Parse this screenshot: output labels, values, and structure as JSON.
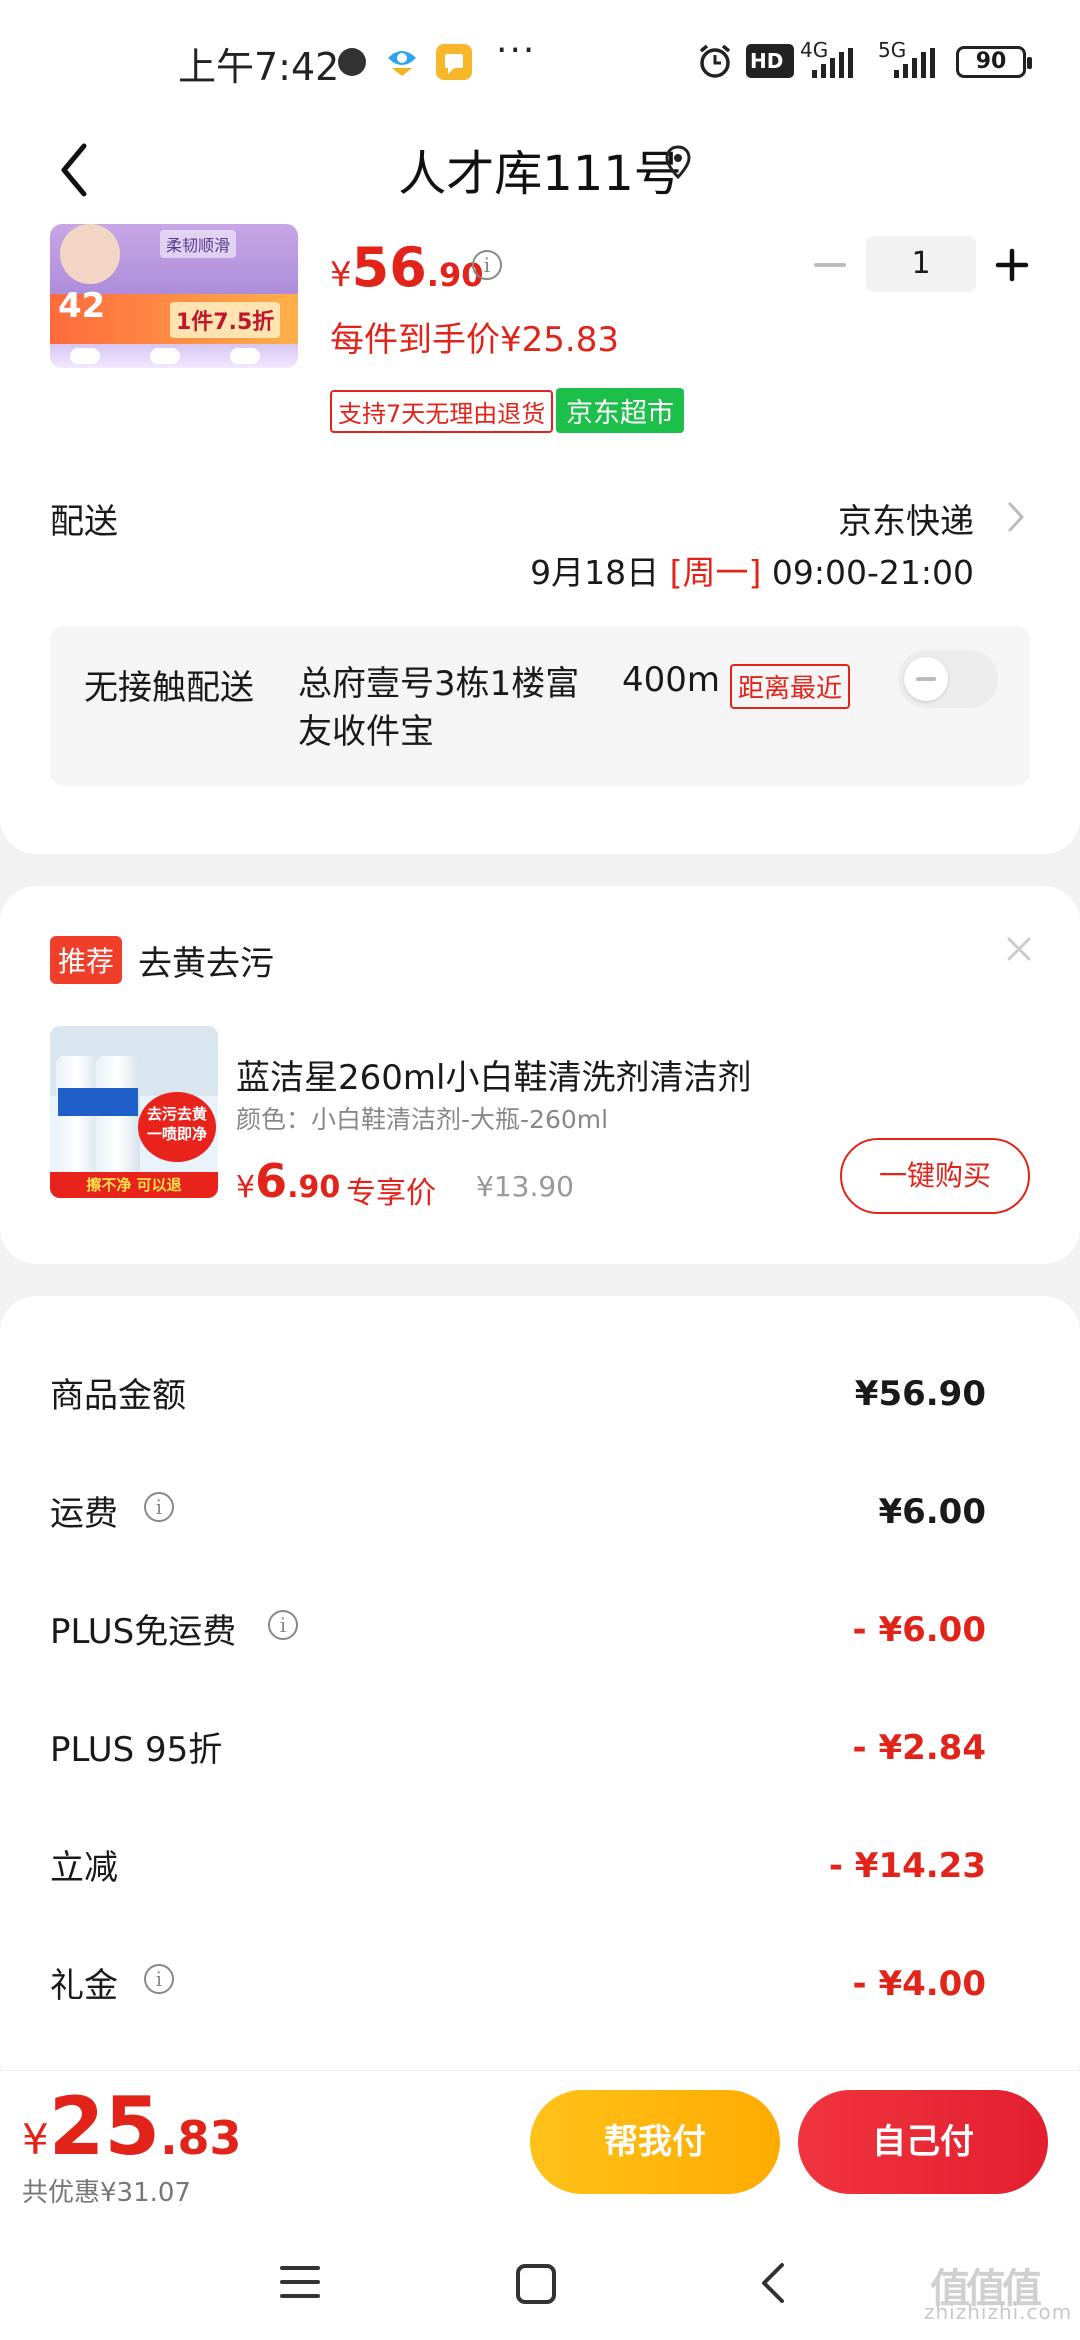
{
  "status_bar": {
    "time": "上午7:42",
    "more": "···",
    "network1": "4G",
    "network2": "5G",
    "hd_label": "HD",
    "battery": "90"
  },
  "header": {
    "title": "人才库111号"
  },
  "product": {
    "price_yen": "¥",
    "price_int": "56",
    "price_dec": ".90",
    "unit_price": "每件到手价¥25.83",
    "tag_return": "支持7天无理由退货",
    "tag_store": "京东超市",
    "quantity": "1",
    "image_text_1": "1件7.5折",
    "image_text_2": "42",
    "image_text_3": "柔韧顺滑"
  },
  "delivery": {
    "label": "配送",
    "method": "京东快递",
    "date": "9月18日 ",
    "weekday": "[周一]",
    "hours": " 09:00-21:00"
  },
  "contactless": {
    "label": "无接触配送",
    "address": "总府壹号3栋1楼富友收件宝",
    "distance": "400m",
    "tag": "距离最近"
  },
  "recommend": {
    "tag": "推荐",
    "title": "去黄去污",
    "name": "蓝洁星260ml小白鞋清洗剂清洁剂",
    "spec": "颜色：小白鞋清洁剂-大瓶-260ml",
    "price_yen": "¥",
    "price_int": "6",
    "price_dec": ".90",
    "exclusive": "专享价",
    "original": "¥13.90",
    "button": "一键购买",
    "image_badge": "去污去黄 一喷即净",
    "image_footer": "擦不净 可以退"
  },
  "summary": {
    "rows": [
      {
        "label": "商品金额",
        "value": "¥56.90"
      },
      {
        "label": "运费",
        "value": "¥6.00"
      },
      {
        "label": "PLUS免运费",
        "value": "- ¥6.00"
      },
      {
        "label": "PLUS 95折",
        "value": "- ¥2.84"
      },
      {
        "label": "立减",
        "value": "- ¥14.23"
      },
      {
        "label": "礼金",
        "value": "- ¥4.00"
      }
    ]
  },
  "footer": {
    "total_yen": "¥",
    "total_int": "25",
    "total_dec": ".83",
    "discount": "共优惠¥31.07",
    "help_pay": "帮我付",
    "self_pay": "自己付"
  },
  "watermark": {
    "site": "zhizhizhi.com",
    "logo": "值值值"
  },
  "colors": {
    "accent_red": "#e2231a",
    "jd_green": "#1dbf4b",
    "button_yellow": "#ffb400"
  }
}
